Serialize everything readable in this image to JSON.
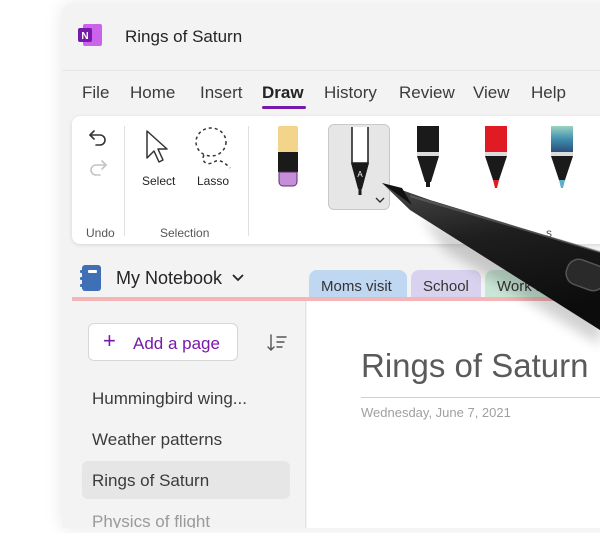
{
  "window": {
    "title": "Rings of Saturn",
    "app_icon_letter": "N",
    "brand_color": "#7719aa"
  },
  "menu": {
    "items": [
      {
        "label": "File"
      },
      {
        "label": "Home"
      },
      {
        "label": "Insert"
      },
      {
        "label": "Draw",
        "active": true
      },
      {
        "label": "History"
      },
      {
        "label": "Review"
      },
      {
        "label": "View"
      },
      {
        "label": "Help"
      }
    ]
  },
  "ribbon": {
    "undo_group_label": "Undo",
    "select_label": "Select",
    "lasso_label": "Lasso",
    "selection_group_label": "Selection",
    "pens_group_label_partial": "s",
    "pens": [
      {
        "name": "highlighter",
        "color": "#f2d58a",
        "tip_color": "#c48ed9"
      },
      {
        "name": "black-pen",
        "color": "#1a1a1a",
        "selected": true,
        "letter": "A"
      },
      {
        "name": "black-marker",
        "color": "#1a1a1a"
      },
      {
        "name": "red-pen",
        "color": "#e01b24"
      },
      {
        "name": "galaxy-pen",
        "color": "#5ab0c8"
      }
    ]
  },
  "notebook": {
    "name": "My Notebook",
    "sections": [
      {
        "label": "Moms visit",
        "color": "#bfd7f0"
      },
      {
        "label": "School",
        "color": "#d9d2ee"
      },
      {
        "label": "Work it",
        "color": "#c9e6d6"
      }
    ]
  },
  "sidebar": {
    "add_page_label": "Add a page",
    "pages": [
      {
        "title": "Hummingbird wing..."
      },
      {
        "title": "Weather patterns"
      },
      {
        "title": "Rings of Saturn",
        "selected": true
      },
      {
        "title": "Physics of flight"
      }
    ]
  },
  "page": {
    "heading": "Rings of Saturn",
    "date": "Wednesday, June 7, 2021"
  },
  "icons": [
    "onenote-logo-icon",
    "undo-icon",
    "redo-icon",
    "select-cursor-icon",
    "lasso-icon",
    "notebook-icon",
    "chevron-down-icon",
    "plus-icon",
    "sort-icon",
    "stylus-pen-icon"
  ]
}
